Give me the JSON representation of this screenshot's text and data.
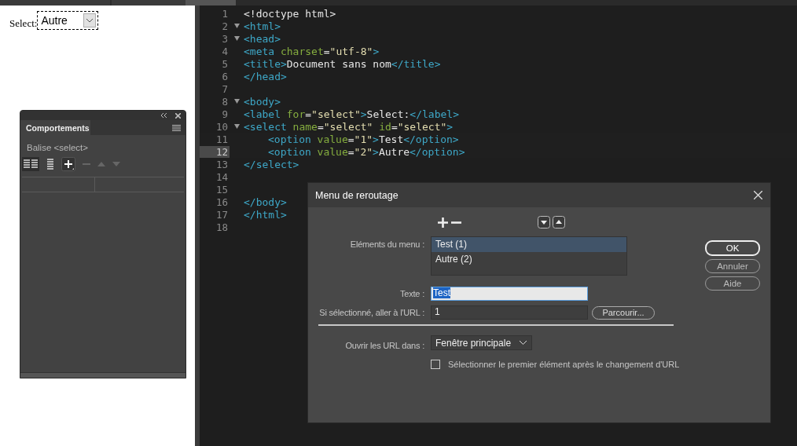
{
  "preview": {
    "label": "Select:",
    "select_value": "Autre"
  },
  "behaviors_panel": {
    "tab": "Comportements",
    "tag_label": "Balise <select>"
  },
  "editor": {
    "lines": [
      {
        "n": "1",
        "fold": false,
        "current": false,
        "indented": false,
        "tokens": [
          {
            "kind": "text",
            "t": "<!doctype html>"
          }
        ]
      },
      {
        "n": "2",
        "fold": true,
        "current": false,
        "indented": false,
        "tokens": [
          {
            "kind": "tag",
            "t": "<html>"
          }
        ]
      },
      {
        "n": "3",
        "fold": true,
        "current": false,
        "indented": false,
        "tokens": [
          {
            "kind": "tag",
            "t": "<head>"
          }
        ]
      },
      {
        "n": "4",
        "fold": false,
        "current": false,
        "indented": false,
        "tokens": [
          {
            "kind": "tag",
            "t": "<meta"
          },
          {
            "kind": "attr",
            "t": " charset"
          },
          {
            "kind": "text",
            "t": "="
          },
          {
            "kind": "str",
            "t": "\"utf-8\""
          },
          {
            "kind": "tag",
            "t": ">"
          }
        ]
      },
      {
        "n": "5",
        "fold": false,
        "current": false,
        "indented": false,
        "tokens": [
          {
            "kind": "tag",
            "t": "<title>"
          },
          {
            "kind": "text",
            "t": "Document sans nom"
          },
          {
            "kind": "tag",
            "t": "</title>"
          }
        ]
      },
      {
        "n": "6",
        "fold": false,
        "current": false,
        "indented": false,
        "tokens": [
          {
            "kind": "tag",
            "t": "</head>"
          }
        ]
      },
      {
        "n": "7",
        "fold": false,
        "current": false
      },
      {
        "n": "8",
        "fold": true,
        "current": false,
        "indented": false,
        "tokens": [
          {
            "kind": "tag",
            "t": "<body>"
          }
        ]
      },
      {
        "n": "9",
        "fold": false,
        "current": false,
        "indented": false,
        "tokens": [
          {
            "kind": "tag",
            "t": "<label"
          },
          {
            "kind": "attr",
            "t": " for"
          },
          {
            "kind": "text",
            "t": "="
          },
          {
            "kind": "str",
            "t": "\"select\""
          },
          {
            "kind": "tag",
            "t": ">"
          },
          {
            "kind": "text",
            "t": "Select:"
          },
          {
            "kind": "tag",
            "t": "</label>"
          }
        ]
      },
      {
        "n": "10",
        "fold": true,
        "current": false,
        "indented": false,
        "tokens": [
          {
            "kind": "tag",
            "t": "<select"
          },
          {
            "kind": "attr",
            "t": " name"
          },
          {
            "kind": "text",
            "t": "="
          },
          {
            "kind": "str",
            "t": "\"select\""
          },
          {
            "kind": "attr",
            "t": " id"
          },
          {
            "kind": "text",
            "t": "="
          },
          {
            "kind": "str",
            "t": "\"select\""
          },
          {
            "kind": "tag",
            "t": ">"
          }
        ]
      },
      {
        "n": "11",
        "fold": false,
        "current": false,
        "indented": true,
        "tokens": [
          {
            "kind": "tag",
            "t": "<option"
          },
          {
            "kind": "attr",
            "t": " value"
          },
          {
            "kind": "text",
            "t": "="
          },
          {
            "kind": "str",
            "t": "\"1\""
          },
          {
            "kind": "tag",
            "t": ">"
          },
          {
            "kind": "text",
            "t": "Test"
          },
          {
            "kind": "tag",
            "t": "</option>"
          }
        ]
      },
      {
        "n": "12",
        "fold": false,
        "current": true,
        "indented": true,
        "tokens": [
          {
            "kind": "tag",
            "t": "<option"
          },
          {
            "kind": "attr",
            "t": " value"
          },
          {
            "kind": "text",
            "t": "="
          },
          {
            "kind": "str",
            "t": "\"2\""
          },
          {
            "kind": "tag",
            "t": ">"
          },
          {
            "kind": "text",
            "t": "Autre"
          },
          {
            "kind": "tag",
            "t": "</option>"
          }
        ]
      },
      {
        "n": "13",
        "fold": false,
        "current": false,
        "indented": false,
        "tokens": [
          {
            "kind": "tag",
            "t": "</select>"
          }
        ]
      },
      {
        "n": "14",
        "fold": false,
        "current": false
      },
      {
        "n": "15",
        "fold": false,
        "current": false
      },
      {
        "n": "16",
        "fold": false,
        "current": false,
        "indented": false,
        "tokens": [
          {
            "kind": "tag",
            "t": "</body>"
          }
        ]
      },
      {
        "n": "17",
        "fold": false,
        "current": false,
        "indented": false,
        "tokens": [
          {
            "kind": "tag",
            "t": "</html>"
          }
        ]
      },
      {
        "n": "18",
        "fold": false,
        "current": false
      }
    ]
  },
  "dialog": {
    "title": "Menu de reroutage",
    "items_label": "Eléments du menu :",
    "items": [
      {
        "text": "Test (1)",
        "selected": true
      },
      {
        "text": "Autre (2)",
        "selected": false
      }
    ],
    "text_label": "Texte :",
    "text_value": "Test",
    "url_label": "Si sélectionné, aller à l'URL :",
    "url_value": "1",
    "browse_button": "Parcourir...",
    "target_label": "Ouvrir les URL dans :",
    "target_value": "Fenêtre principale",
    "reset_checkbox": {
      "label": "Sélectionner le premier élément après le changement d'URL",
      "checked": false
    },
    "buttons": [
      {
        "label": "OK",
        "default": true
      },
      {
        "label": "Annuler",
        "default": false
      },
      {
        "label": "Aide",
        "default": false
      }
    ]
  }
}
